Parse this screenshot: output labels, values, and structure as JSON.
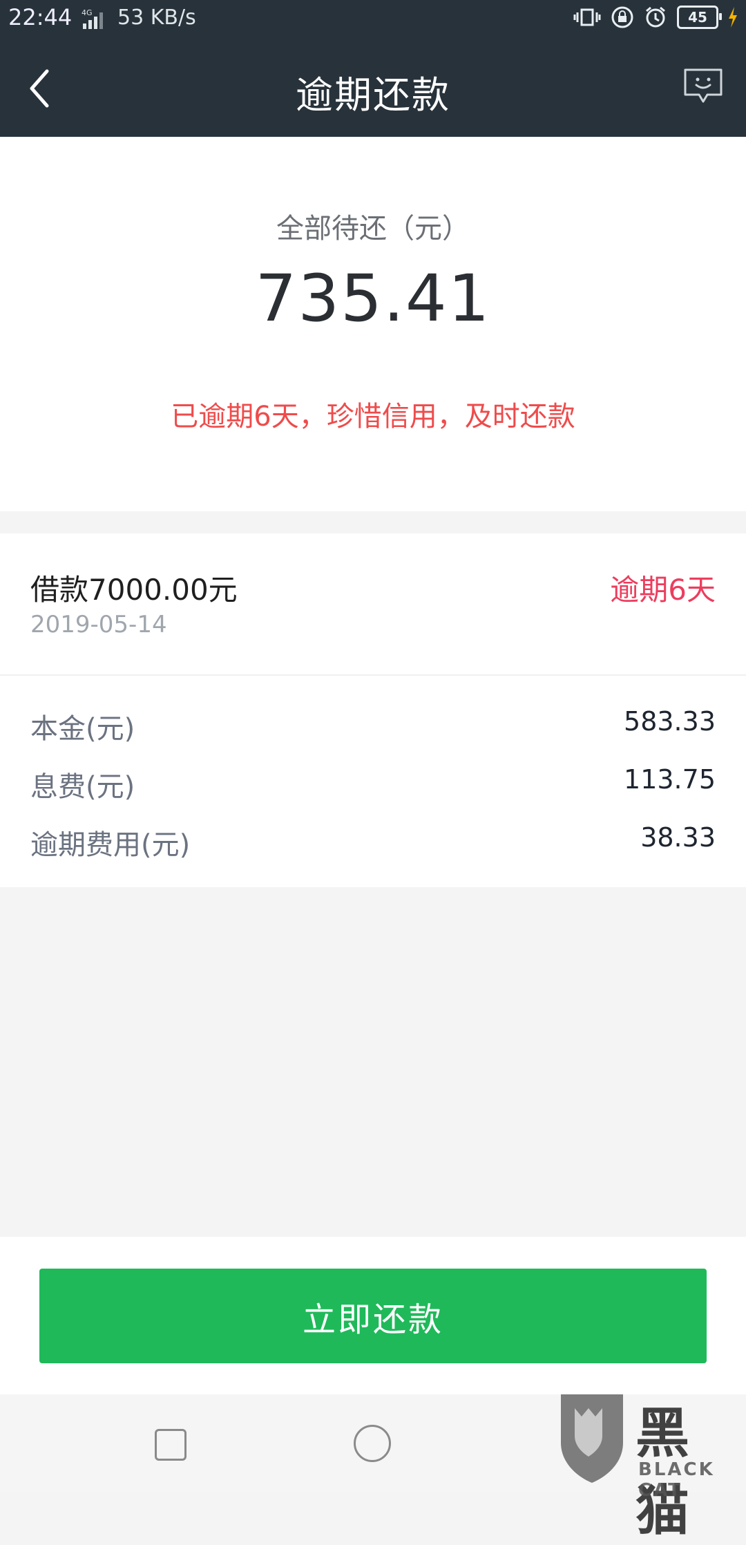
{
  "status_bar": {
    "time": "22:44",
    "network": "4G",
    "speed": "53 KB/s",
    "battery": "45"
  },
  "header": {
    "title": "逾期还款",
    "back_icon": "chevron-left-icon",
    "chat_icon": "chat-smile-icon"
  },
  "summary": {
    "label": "全部待还（元）",
    "amount": "735.41",
    "warning": "已逾期6天，珍惜信用，及时还款"
  },
  "loan": {
    "title": "借款7000.00元",
    "date": "2019-05-14",
    "status": "逾期6天"
  },
  "details": [
    {
      "label": "本金(元)",
      "value": "583.33"
    },
    {
      "label": "息费(元)",
      "value": "113.75"
    },
    {
      "label": "逾期费用(元)",
      "value": "38.33"
    }
  ],
  "action": {
    "pay_label": "立即还款"
  },
  "watermark": {
    "cn": "黑猫",
    "en": "BLACK CAT"
  },
  "colors": {
    "header_bg": "#28323a",
    "warning_red": "#ef4b4b",
    "status_red": "#ec3d5e",
    "pay_green": "#1fb95a"
  }
}
